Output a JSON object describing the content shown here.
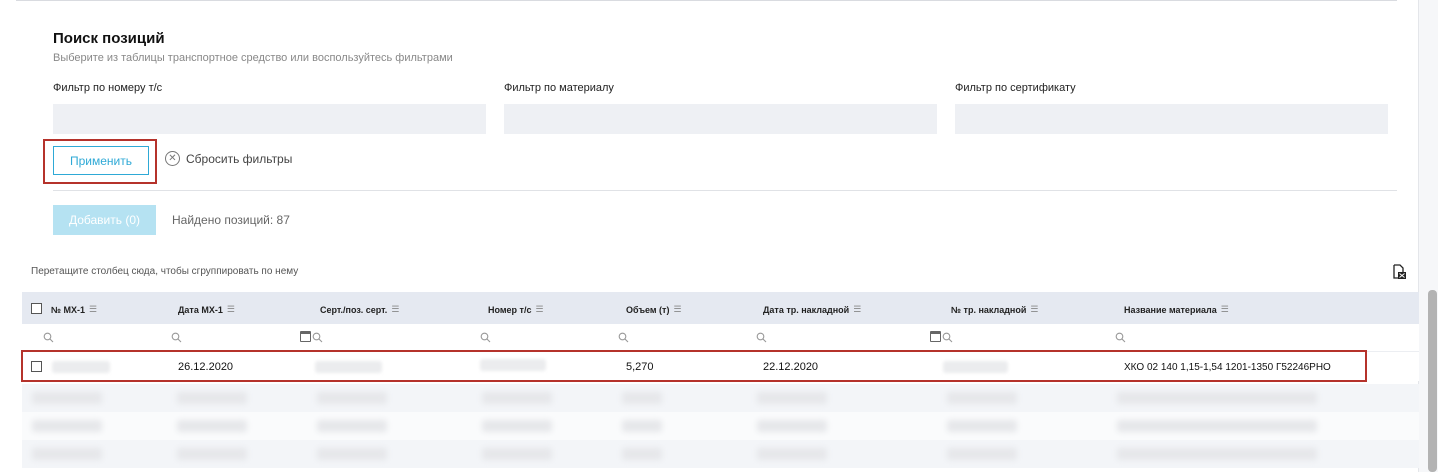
{
  "section": {
    "title": "Поиск позиций",
    "subtitle": "Выберите из таблицы транспортное средство или воспользуйтесь фильтрами"
  },
  "filters": {
    "vehicle_label": "Фильтр по номеру т/с",
    "vehicle_value": "",
    "material_label": "Фильтр по материалу",
    "material_value": "",
    "certificate_label": "Фильтр по сертификату",
    "certificate_value": ""
  },
  "actions": {
    "apply_label": "Применить",
    "reset_label": "Сбросить фильтры",
    "add_label": "Добавить (0)",
    "found_text": "Найдено позиций: 87"
  },
  "grid": {
    "group_hint": "Перетащите столбец сюда, чтобы сгруппировать по нему",
    "columns": [
      "№ МХ-1",
      "Дата МХ-1",
      "Серт./поз. серт.",
      "Номер т/с",
      "Объем (т)",
      "Дата тр. накладной",
      "№ тр. накладной",
      "Название материала"
    ],
    "rows": [
      {
        "mx1_number": "",
        "mx1_date": "26.12.2020",
        "certificate": "",
        "vehicle_number": "",
        "volume": "5,270",
        "waybill_date": "22.12.2020",
        "waybill_number": "",
        "material_name": "ХКО 02 140 1,15-1,54 1201-1350 Г52246РНО"
      }
    ]
  },
  "colors": {
    "accent": "#2ea9d6",
    "highlight": "#b5322b",
    "header_bg": "#e5e9f1",
    "input_bg": "#eef0f4"
  }
}
